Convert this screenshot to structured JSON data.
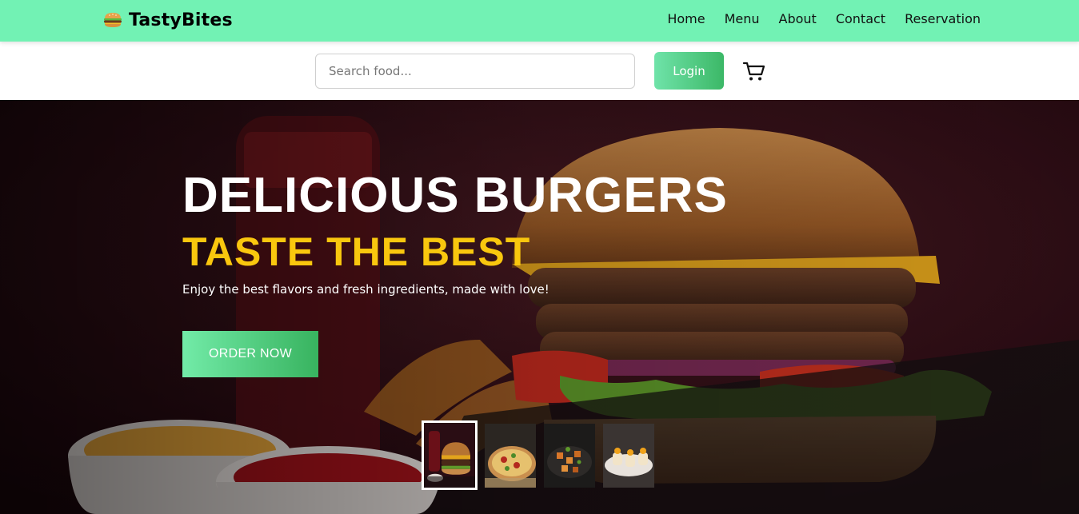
{
  "brand": {
    "name": "TastyBites",
    "icon": "burger-icon"
  },
  "nav": {
    "links": [
      {
        "label": "Home"
      },
      {
        "label": "Menu"
      },
      {
        "label": "About"
      },
      {
        "label": "Contact"
      },
      {
        "label": "Reservation"
      }
    ]
  },
  "search": {
    "placeholder": "Search food...",
    "value": ""
  },
  "login": {
    "label": "Login"
  },
  "cart": {
    "icon": "cart-icon"
  },
  "hero": {
    "title": "DELICIOUS BURGERS",
    "subtitle": "TASTE THE BEST",
    "description": "Enjoy the best flavors and fresh ingredients, made with love!",
    "cta": "ORDER NOW"
  },
  "thumbnails": [
    {
      "name": "burger-thumbnail",
      "active": true
    },
    {
      "name": "pizza-thumbnail",
      "active": false
    },
    {
      "name": "salad-thumbnail",
      "active": false
    },
    {
      "name": "dessert-thumbnail",
      "active": false
    }
  ],
  "colors": {
    "nav_bg": "#72f2b4",
    "accent_green": "#3cb867",
    "subtitle_yellow": "#f9c70e",
    "hero_bg": "#2a0d14"
  }
}
